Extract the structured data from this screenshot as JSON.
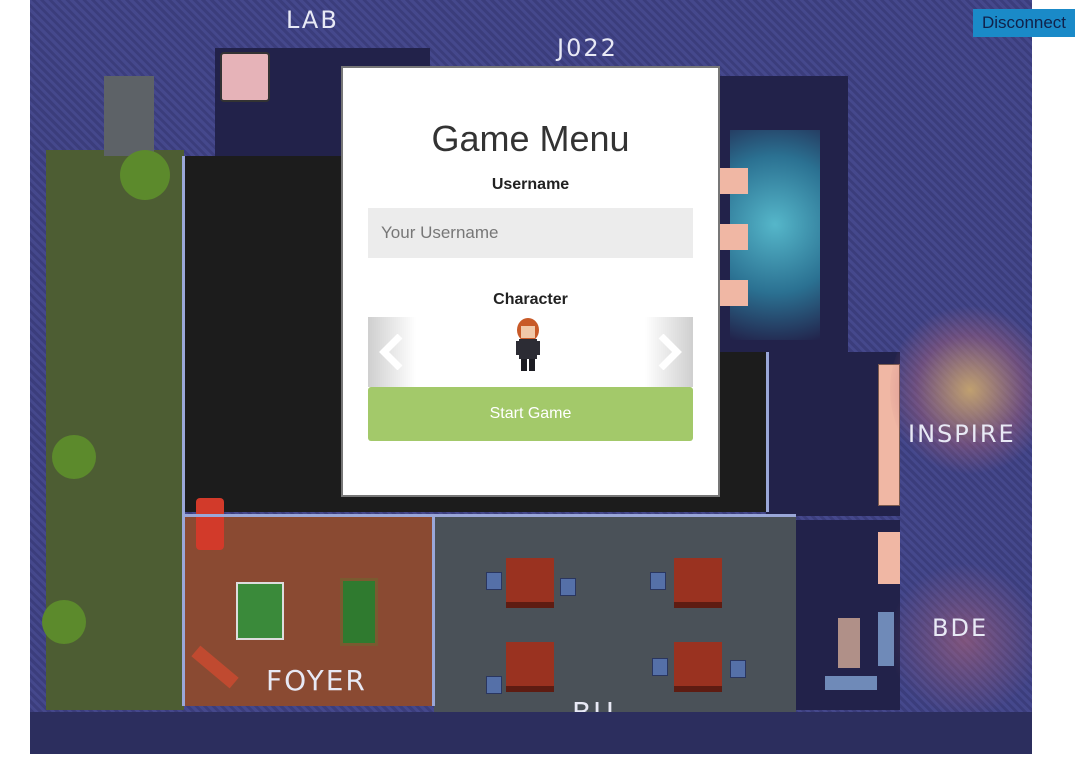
{
  "header": {
    "disconnect_label": "Disconnect"
  },
  "map": {
    "rooms": {
      "lab": "LAB",
      "j022": "J022",
      "inspire": "INSPIRE",
      "bde": "BDE",
      "foyer": "FOYER",
      "bu": "BU"
    }
  },
  "menu": {
    "title": "Game Menu",
    "username_label": "Username",
    "username_placeholder": "Your Username",
    "username_value": "",
    "character_label": "Character",
    "start_label": "Start Game"
  },
  "colors": {
    "accent": "#1a8ac8",
    "start_button": "#a3c96a",
    "map_background": "#3d3f80"
  }
}
